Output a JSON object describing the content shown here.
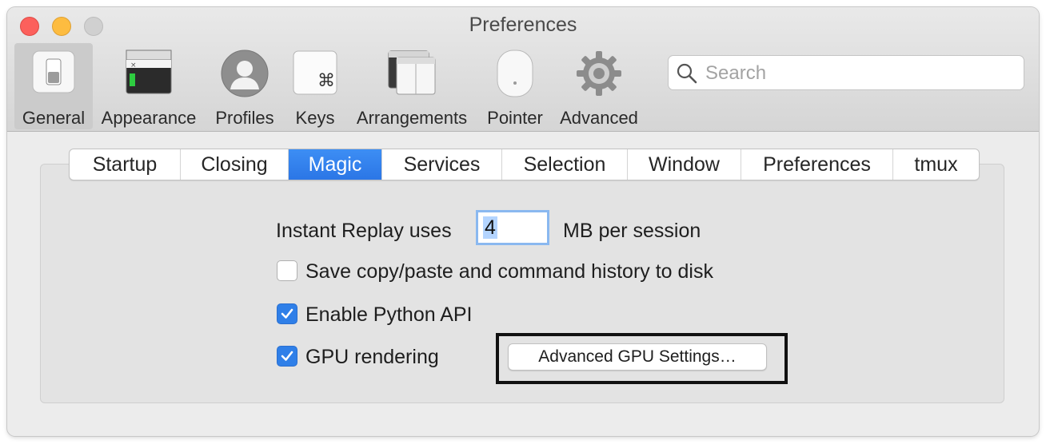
{
  "window": {
    "title": "Preferences"
  },
  "toolbar": {
    "items": [
      {
        "label": "General",
        "icon": "general-switch-icon",
        "selected": true
      },
      {
        "label": "Appearance",
        "icon": "appearance-window-icon",
        "selected": false
      },
      {
        "label": "Profiles",
        "icon": "profile-person-icon",
        "selected": false
      },
      {
        "label": "Keys",
        "icon": "command-key-icon",
        "selected": false
      },
      {
        "label": "Arrangements",
        "icon": "arrangements-windows-icon",
        "selected": false
      },
      {
        "label": "Pointer",
        "icon": "mouse-icon",
        "selected": false
      },
      {
        "label": "Advanced",
        "icon": "gear-icon",
        "selected": false
      }
    ]
  },
  "search": {
    "placeholder": "Search",
    "value": ""
  },
  "tabs": [
    {
      "label": "Startup",
      "active": false
    },
    {
      "label": "Closing",
      "active": false
    },
    {
      "label": "Magic",
      "active": true
    },
    {
      "label": "Services",
      "active": false
    },
    {
      "label": "Selection",
      "active": false
    },
    {
      "label": "Window",
      "active": false
    },
    {
      "label": "Preferences",
      "active": false
    },
    {
      "label": "tmux",
      "active": false
    }
  ],
  "magic": {
    "instant_replay_label": "Instant Replay uses",
    "instant_replay_value": "4",
    "instant_replay_unit": "MB per session",
    "save_history_label": "Save copy/paste and command history to disk",
    "save_history_checked": false,
    "python_api_label": "Enable Python API",
    "python_api_checked": true,
    "gpu_rendering_label": "GPU rendering",
    "gpu_rendering_checked": true,
    "advanced_gpu_button": "Advanced GPU Settings…"
  },
  "colors": {
    "accent": "#2f7fe8",
    "highlight_box": "#111111"
  }
}
